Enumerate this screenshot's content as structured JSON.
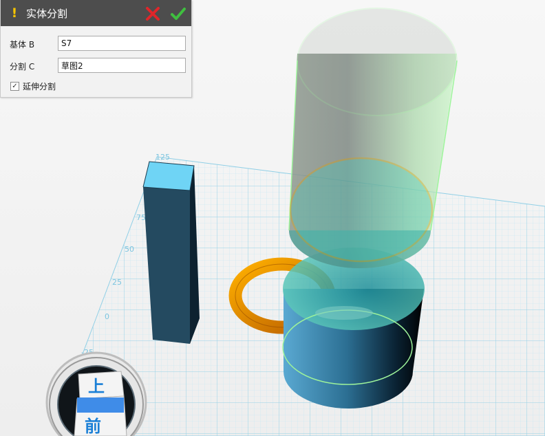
{
  "panel": {
    "title": "实体分割",
    "cancel_icon": "close-x-icon",
    "confirm_icon": "checkmark-icon",
    "warning_icon": "exclamation-icon",
    "base_label": "基体 B",
    "base_value": "S7",
    "split_label": "分割 C",
    "split_value": "草图2",
    "extend_label": "延伸分割",
    "extend_checked": true,
    "extend_check_glyph": "✓"
  },
  "grid_ruler": {
    "labels": [
      "125",
      "75",
      "50",
      "25",
      "0",
      "-25"
    ]
  },
  "view_cube": {
    "top_face": "上",
    "front_face": "前"
  },
  "colors": {
    "header_bg": "#4d4d4d",
    "grid_line": "#9fd8ec",
    "box_blue": "#6fd4f5",
    "handle_orange": "#f08a00",
    "cylinder_green": "#b8f0b4",
    "cylinder_blue": "#4a9bc7"
  }
}
